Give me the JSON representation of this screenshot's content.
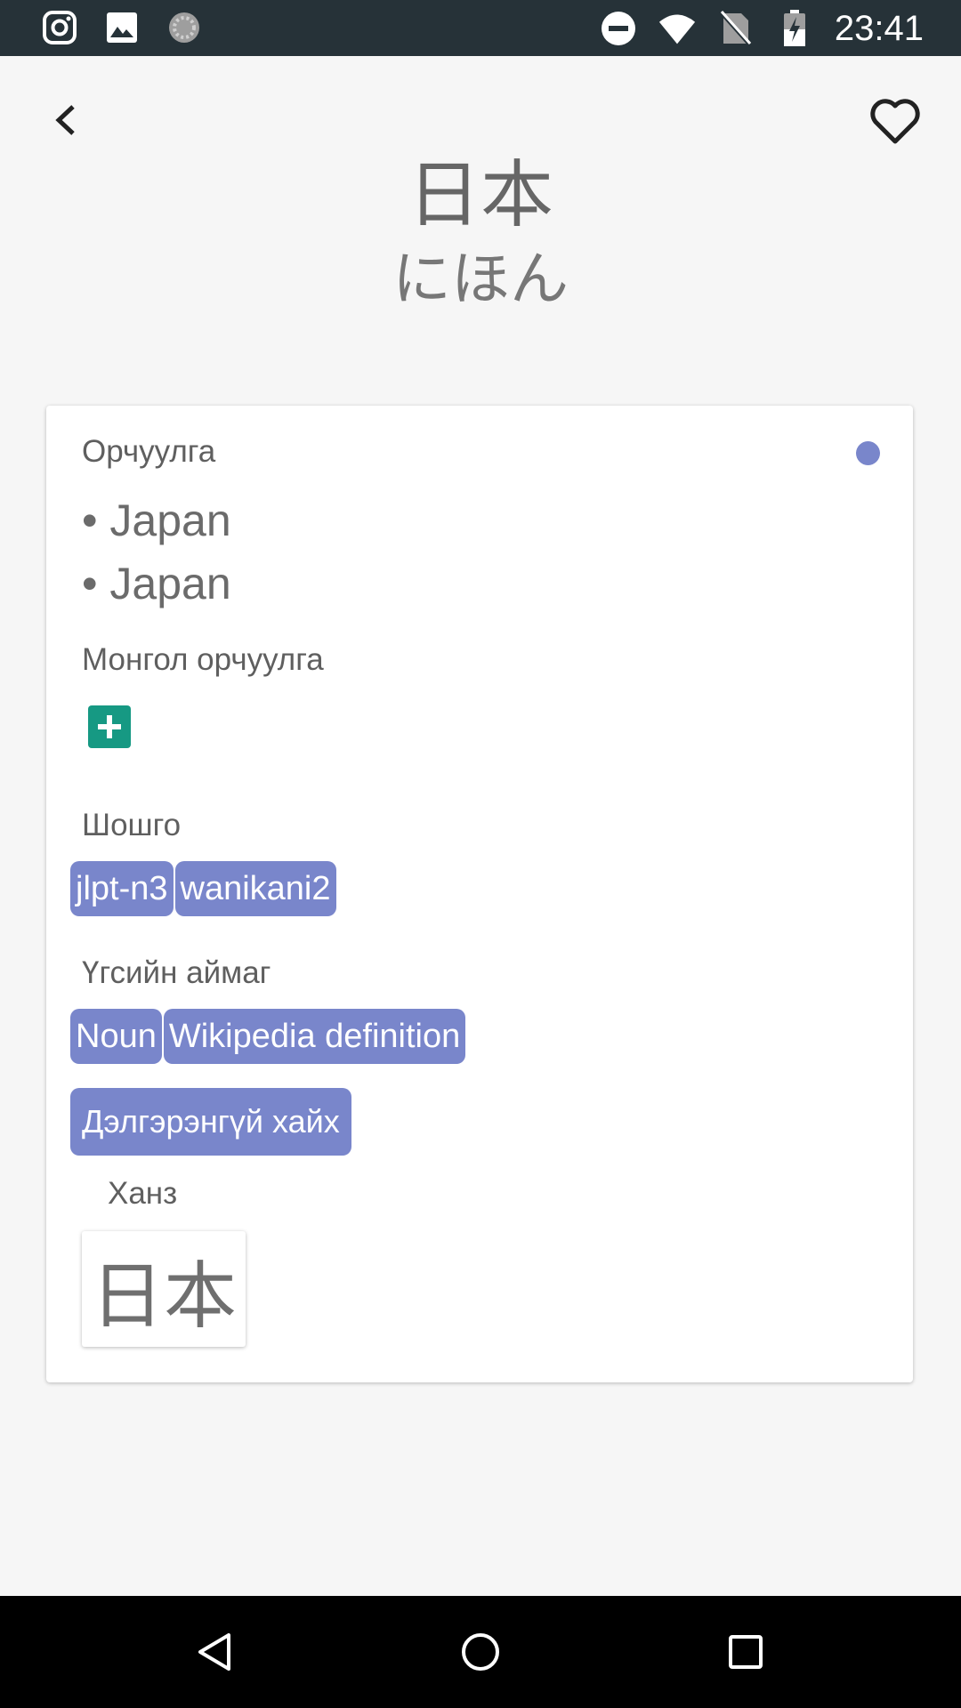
{
  "status_bar": {
    "time": "23:41",
    "left_icons": [
      "instagram-icon",
      "image-icon",
      "loading-icon"
    ],
    "right_icons": [
      "do-not-disturb-icon",
      "wifi-icon",
      "no-sim-icon",
      "battery-charging-icon"
    ]
  },
  "header": {
    "word": "日本",
    "reading": "にほん"
  },
  "card": {
    "translation_label": "Орчуулга",
    "meanings": [
      "• Japan",
      "• Japan"
    ],
    "mongolian_label": "Монгол орчуулга",
    "tags_label": "Шошго",
    "tags": [
      "jlpt-n3",
      "wanikani2"
    ],
    "pos_label": "Үгсийн аймаг",
    "pos": [
      "Noun",
      "Wikipedia definition"
    ],
    "search_label": "Дэлгэрэнгүй хайх",
    "kanji_label": "Ханз",
    "kanji": "日本"
  },
  "colors": {
    "accent": "#7986cb",
    "add": "#169983",
    "status_bar": "#263238"
  }
}
